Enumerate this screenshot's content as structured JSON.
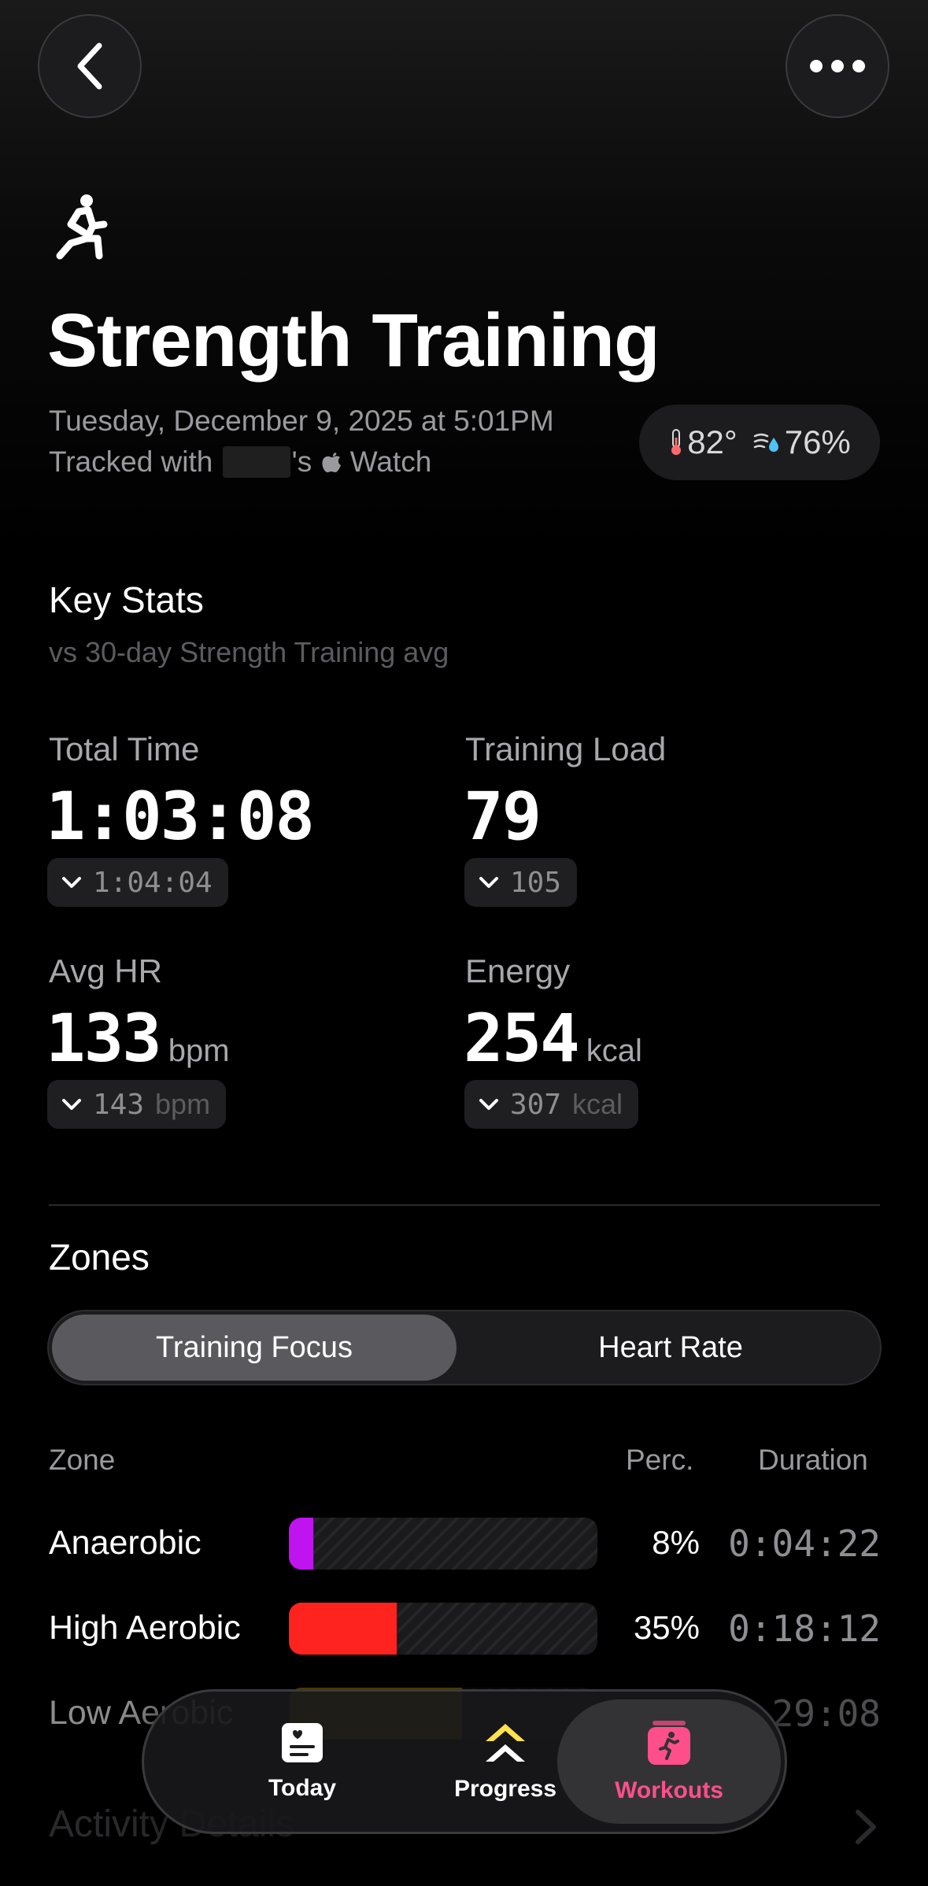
{
  "nav": {
    "back_icon": "chevron-left-icon",
    "more_icon": "ellipsis-icon"
  },
  "workout": {
    "icon": "strength-training-icon",
    "title": "Strength Training",
    "date_line": "Tuesday, December 9, 2025 at 5:01PM",
    "tracked_prefix": "Tracked with",
    "tracked_suffix": "'s",
    "device": "Watch",
    "temperature": "82°",
    "humidity": "76%"
  },
  "key_stats": {
    "title": "Key Stats",
    "subtitle": "vs 30-day Strength Training avg",
    "total_time": {
      "label": "Total Time",
      "value": "1:03:08",
      "avg": "1:04:04"
    },
    "training_load": {
      "label": "Training Load",
      "value": "79",
      "avg": "105"
    },
    "avg_hr": {
      "label": "Avg HR",
      "value": "133",
      "unit": "bpm",
      "avg": "143",
      "avg_unit": "bpm"
    },
    "energy": {
      "label": "Energy",
      "value": "254",
      "unit": "kcal",
      "avg": "307",
      "avg_unit": "kcal"
    }
  },
  "zones": {
    "title": "Zones",
    "tabs": [
      "Training Focus",
      "Heart Rate"
    ],
    "selected_tab": "Training Focus",
    "headers": {
      "zone": "Zone",
      "perc": "Perc.",
      "duration": "Duration"
    },
    "rows": [
      {
        "name": "Anaerobic",
        "perc": "8%",
        "fraction": 0.08,
        "duration": "0:04:22",
        "color": "#bf14f0"
      },
      {
        "name": "High Aerobic",
        "perc": "35%",
        "fraction": 0.35,
        "duration": "0:18:12",
        "color": "#ff231f"
      },
      {
        "name": "Low Aerobic",
        "perc": "",
        "fraction": 0.56,
        "duration": "29:08",
        "color": "#d4a90a"
      }
    ]
  },
  "activity": {
    "label": "Activity Details"
  },
  "tabbar": {
    "tabs": [
      {
        "label": "Today",
        "icon": "today-icon"
      },
      {
        "label": "Progress",
        "icon": "progress-icon"
      },
      {
        "label": "Workouts",
        "icon": "workouts-icon"
      }
    ],
    "active": "Workouts",
    "active_color": "#ff4f8b"
  }
}
